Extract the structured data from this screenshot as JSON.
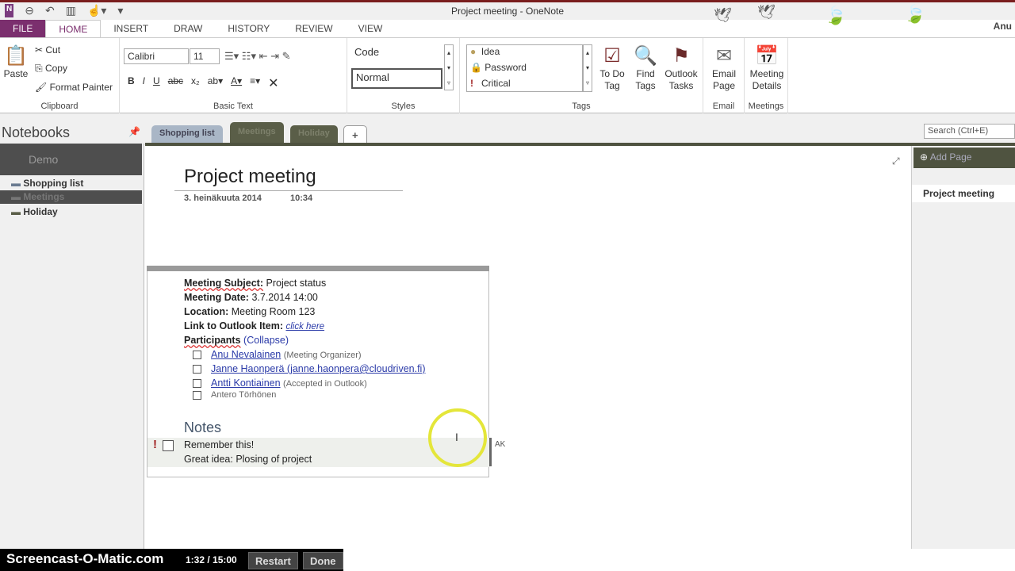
{
  "window": {
    "title": "Project meeting - OneNote",
    "user": "Anu",
    "app_icon": "N"
  },
  "tabs": [
    "FILE",
    "HOME",
    "INSERT",
    "DRAW",
    "HISTORY",
    "REVIEW",
    "VIEW"
  ],
  "active_tab": "HOME",
  "ribbon": {
    "clipboard": {
      "paste": "Paste",
      "cut": "Cut",
      "copy": "Copy",
      "format_painter": "Format Painter",
      "label": "Clipboard"
    },
    "basic_text": {
      "font": "Calibri",
      "size": "11",
      "bold": "B",
      "italic": "I",
      "underline": "U",
      "strike": "abc",
      "subscript": "x₂",
      "label": "Basic Text"
    },
    "styles": {
      "items": [
        "Code",
        "Normal"
      ],
      "label": "Styles"
    },
    "tags": {
      "items": [
        "Idea",
        "Password",
        "Critical"
      ],
      "todo": "To Do Tag",
      "find": "Find Tags",
      "outlook": "Outlook Tasks",
      "label": "Tags"
    },
    "email": {
      "button": "Email Page",
      "label": "Email"
    },
    "meetings": {
      "button": "Meeting Details",
      "label": "Meetings"
    }
  },
  "notebooks": {
    "header": "Notebooks",
    "notebook": "Demo",
    "sections": [
      "Shopping list",
      "Meetings",
      "Holiday"
    ],
    "active_section": "Meetings"
  },
  "section_tabs": [
    "Shopping list",
    "Meetings",
    "Holiday",
    "+"
  ],
  "search": {
    "placeholder": "Search (Ctrl+E)"
  },
  "page": {
    "title": "Project meeting",
    "date": "3. heinäkuuta 2014",
    "time": "10:34",
    "subject_label": "Meeting Subject:",
    "subject": "Project status",
    "date_label": "Meeting Date:",
    "meeting_date": "3.7.2014 14:00",
    "location_label": "Location:",
    "location": "Meeting Room 123",
    "link_label": "Link to Outlook Item:",
    "link": "click here",
    "participants_label": "Participants",
    "collapse": "(Collapse)",
    "participants": [
      {
        "name": "Anu Nevalainen",
        "note": "(Meeting Organizer)"
      },
      {
        "name": "Janne Haonperä (janne.haonpera@cloudriven.fi)",
        "note": ""
      },
      {
        "name": "Antti Kontiainen",
        "note": "(Accepted in Outlook)"
      },
      {
        "name": "Antero Törhönen",
        "note": ""
      }
    ],
    "notes_heading": "Notes",
    "notes": [
      "Remember this!",
      "Great idea: Plosing of project"
    ],
    "author_initials": "AK"
  },
  "page_list": {
    "add_page": "Add Page",
    "items": [
      "Project meeting"
    ]
  },
  "recorder": {
    "brand": "Screencast-O-Matic.com",
    "time": "1:32 / 15:00",
    "restart": "Restart",
    "done": "Done"
  },
  "colors": {
    "file_tab": "#7b2f6e",
    "section_dark": "#4f5340",
    "section_blue": "#a9b6c6",
    "critical": "#a02020"
  }
}
